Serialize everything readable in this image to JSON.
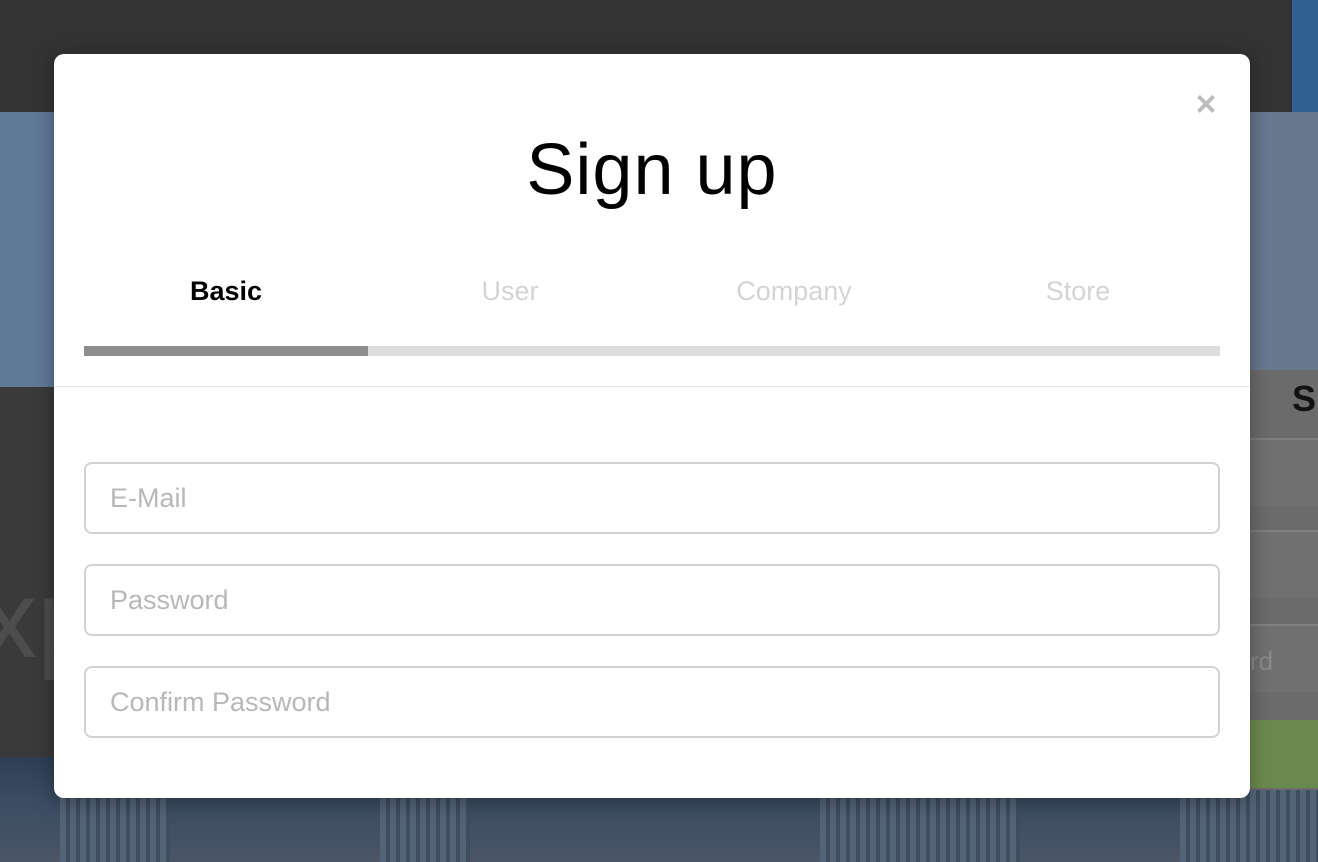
{
  "background": {
    "partial_heading": "S",
    "partial_input_text": "rd",
    "partial_big_text": "xp"
  },
  "modal": {
    "close_glyph": "×",
    "title": "Sign up",
    "steps": [
      {
        "label": "Basic",
        "active": true
      },
      {
        "label": "User",
        "active": false
      },
      {
        "label": "Company",
        "active": false
      },
      {
        "label": "Store",
        "active": false
      }
    ],
    "progress": {
      "current_step": 1,
      "total_steps": 4,
      "fraction": 0.25
    },
    "fields": {
      "email_placeholder": "E-Mail",
      "password_placeholder": "Password",
      "confirm_password_placeholder": "Confirm Password"
    }
  },
  "colors": {
    "progress_fill": "#8d8d8d",
    "progress_track": "#dddddd",
    "active_step": "#000000",
    "inactive_step": "#d4d4d4"
  }
}
